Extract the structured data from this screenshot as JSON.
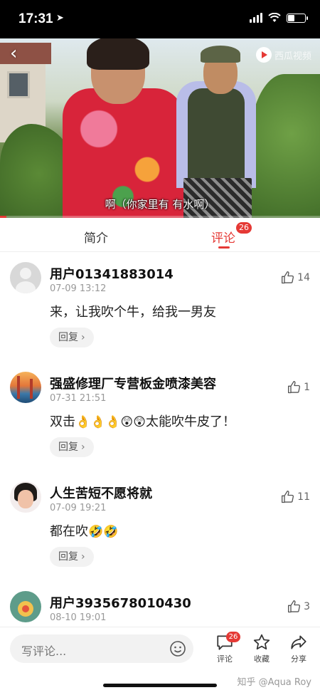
{
  "status_bar": {
    "time": "17:31",
    "battery_level": 0.4
  },
  "video": {
    "subtitle": "啊（你家里有 有水啊）",
    "logo_text": "西瓜视频",
    "progress": 0.02
  },
  "tabs": {
    "intro": "简介",
    "comments": "评论",
    "comments_count": "26"
  },
  "comments": [
    {
      "name": "用户01341883014",
      "time": "07-09 13:12",
      "text": "来，让我吹个牛，给我一男友",
      "likes": "14",
      "reply": "回复"
    },
    {
      "name": "强盛修理厂专营板金喷漆美容",
      "time": "07-31 21:51",
      "text_prefix": "双击",
      "emoji_run": "👌👌👌😲😲",
      "text_suffix": "太能吹牛皮了！",
      "likes": "1",
      "reply": "回复"
    },
    {
      "name": "人生苦短不愿将就",
      "time": "07-09 19:21",
      "text_prefix": "都在吹",
      "emoji_run": "🤣🤣",
      "likes": "11",
      "reply": "回复"
    },
    {
      "name": "用户3935678010430",
      "time": "08-10 19:01",
      "likes": "3"
    }
  ],
  "bottom_bar": {
    "placeholder": "写评论...",
    "comment_label": "评论",
    "comment_badge": "26",
    "fav_label": "收藏",
    "share_label": "分享",
    "watermark": "知乎 @Aqua Roy"
  },
  "colors": {
    "accent": "#e53935"
  }
}
